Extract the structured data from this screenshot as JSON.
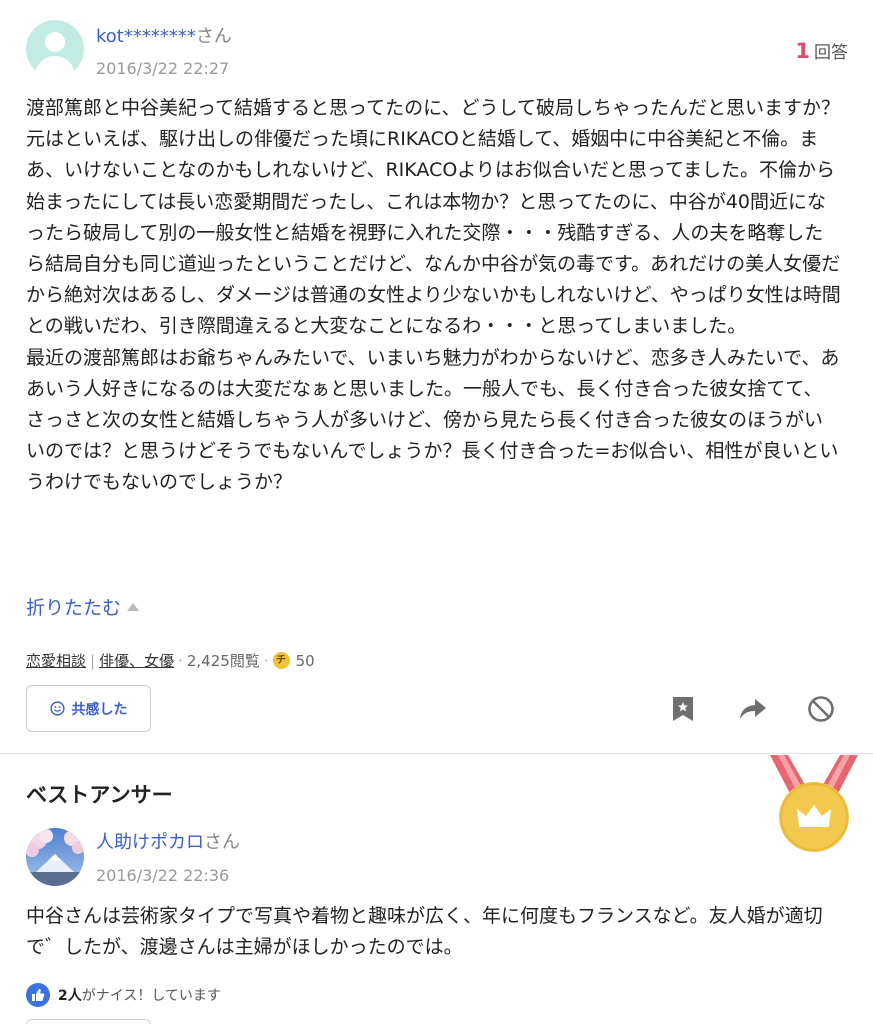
{
  "question": {
    "username": "kot********",
    "honorific": "さん",
    "timestamp": "2016/3/22 22:27",
    "answer_count": "1",
    "answer_label": "回答",
    "body": "渡部篤郎と中谷美紀って結婚すると思ってたのに、どうして破局しちゃったんだと思いますか？\n元はといえば、駆け出しの俳優だった頃にRIKACOと結婚して、婚姻中に中谷美紀と不倫。まあ、いけないことなのかもしれないけど、RIKACOよりはお似合いだと思ってました。不倫から始まったにしては長い恋愛期間だったし、これは本物か？と思ってたのに、中谷が40間近になったら破局して別の一般女性と結婚を視野に入れた交際・・・残酷すぎる、人の夫を略奪したら結局自分も同じ道辿ったということだけど、なんか中谷が気の毒です。あれだけの美人女優だから絶対次はあるし、ダメージは普通の女性より少ないかもしれないけど、やっぱり女性は時間との戦いだわ、引き際間違えると大変なことになるわ・・・と思ってしまいました。\n最近の渡部篤郎はお爺ちゃんみたいで、いまいち魅力がわからないけど、恋多き人みたいで、ああいう人好きになるのは大変だなぁと思いました。一般人でも、長く付き合った彼女捨てて、さっさと次の女性と結婚しちゃう人が多いけど、傍から見たら長く付き合った彼女のほうがいいのでは？と思うけどそうでもないんでしょうか？長く付き合った=お似合い、相性が良いというわけでもないのでしょうか？",
    "collapse_label": "折りたたむ",
    "category1": "恋愛相談",
    "category2": "俳優、女優",
    "views": "2,425閲覧",
    "coin_symbol": "チ",
    "coins": "50",
    "empathy_label": "共感した"
  },
  "best_answer": {
    "section_title": "ベストアンサー",
    "username": "人助けポカロ",
    "honorific": "さん",
    "timestamp": "2016/3/22 22:36",
    "body": "中谷さんは芸術家タイプで写真や着物と趣味が広く、年に何度もフランスなど。友人婚が適切で゛したが、渡邊さんは主婦がほしかったのでは。",
    "nice_count": "2人",
    "nice_text": "がナイス！しています"
  },
  "icons": {
    "bookmark": "bookmark-icon",
    "share": "share-arrow-icon",
    "block": "block-icon",
    "medal": "best-answer-medal-icon",
    "thumb": "thumbs-up-icon"
  },
  "colors": {
    "link": "#3b5fc9",
    "answer_count": "#e04d66",
    "medal_gold": "#f2c94c",
    "medal_ribbon": "#e8666f",
    "avatar_bg": "#c2ebe4"
  }
}
